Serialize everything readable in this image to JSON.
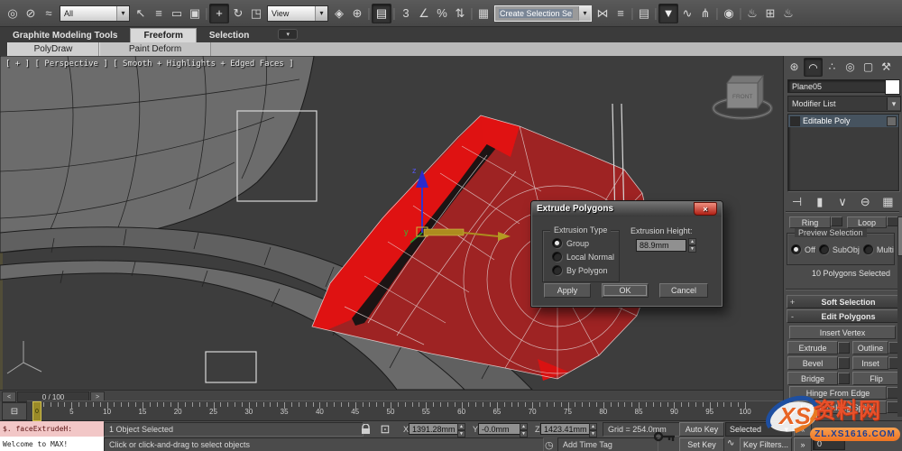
{
  "colors": {
    "selected_face_red": "#e01010",
    "mesh_red": "#9e2323",
    "mesh_gray": "#6c6c6c",
    "viewport_bg": "#3d3d3d",
    "panel_bg": "#4b4b4b",
    "gizmo_z_blue": "#3333cc",
    "gizmo_x_yellow": "#ad8c1f",
    "listener_pink": "#f2c7c7",
    "watermark_orange": "#f08233",
    "watermark_red": "#e8502a",
    "watermark_blue": "#1e4fa1"
  },
  "toolbar": {
    "selection_filter_value": "All",
    "coord_system_value": "View",
    "named_selection_placeholder": "Create Selection Se",
    "dd_arrow": "▾",
    "seg1": [
      {
        "name": "select-and-link-icon",
        "glyph": "◎"
      },
      {
        "name": "unlink-selection-icon",
        "glyph": "⊘"
      },
      {
        "name": "bind-to-space-warp-icon",
        "glyph": "≈"
      }
    ],
    "seg2": [
      {
        "name": "select-object-icon",
        "glyph": "↖"
      },
      {
        "name": "select-by-name-icon",
        "glyph": "≡"
      },
      {
        "name": "rectangular-selection-region-icon",
        "glyph": "▭"
      },
      {
        "name": "window-crossing-icon",
        "glyph": "▣"
      },
      {
        "name": "separator",
        "glyph": "|"
      },
      {
        "name": "select-and-move-icon",
        "glyph": "+",
        "active": true
      },
      {
        "name": "select-and-rotate-icon",
        "glyph": "↻"
      },
      {
        "name": "select-and-scale-icon",
        "glyph": "◳"
      }
    ],
    "seg3": [
      {
        "name": "use-pivot-point-center-icon",
        "glyph": "◈"
      },
      {
        "name": "select-and-manipulate-icon",
        "glyph": "⊕"
      },
      {
        "name": "separator",
        "glyph": "|"
      },
      {
        "name": "keyboard-shortcut-override-icon",
        "glyph": "▤",
        "active": true
      },
      {
        "name": "separator",
        "glyph": "|"
      },
      {
        "name": "snaps-toggle-3d-icon",
        "glyph": "3"
      },
      {
        "name": "angle-snap-icon",
        "glyph": "∠"
      },
      {
        "name": "percent-snap-icon",
        "glyph": "%"
      },
      {
        "name": "spinner-snap-icon",
        "glyph": "⇅"
      },
      {
        "name": "separator",
        "glyph": "|"
      },
      {
        "name": "edit-named-selection-sets-icon",
        "glyph": "▦"
      }
    ],
    "seg4": [
      {
        "name": "mirror-icon",
        "glyph": "⋈"
      },
      {
        "name": "align-icon",
        "glyph": "≡"
      },
      {
        "name": "separator",
        "glyph": "|"
      },
      {
        "name": "layer-manager-icon",
        "glyph": "▤"
      },
      {
        "name": "separator",
        "glyph": "|"
      },
      {
        "name": "graphite-ribbon-toggle-icon",
        "glyph": "▼",
        "active": true
      },
      {
        "name": "curve-editor-icon",
        "glyph": "∿"
      },
      {
        "name": "schematic-view-icon",
        "glyph": "⋔"
      },
      {
        "name": "separator",
        "glyph": "|"
      },
      {
        "name": "material-editor-icon",
        "glyph": "◉"
      },
      {
        "name": "separator",
        "glyph": "|"
      },
      {
        "name": "render-setup-icon",
        "glyph": "♨"
      },
      {
        "name": "rendered-frame-window-icon",
        "glyph": "⊞"
      },
      {
        "name": "render-production-icon",
        "glyph": "♨"
      }
    ]
  },
  "ribbon": {
    "tabs": [
      {
        "label": "Graphite Modeling Tools"
      },
      {
        "label": "Freeform"
      },
      {
        "label": "Selection"
      }
    ],
    "minimize_glyph": "▾",
    "subtabs": [
      {
        "label": "PolyDraw"
      },
      {
        "label": "Paint Deform"
      }
    ]
  },
  "viewport": {
    "label": "[ + ] [ Perspective ] [ Smooth + Highlights + Edged Faces ]",
    "viewcube_face": "FRONT",
    "gizmo_z": "z",
    "gizmo_y": "y"
  },
  "dialog": {
    "title": "Extrude Polygons",
    "close_glyph": "×",
    "group_label": "Extrusion Type",
    "radios": [
      {
        "label": "Group",
        "selected": true
      },
      {
        "label": "Local Normal",
        "selected": false
      },
      {
        "label": "By Polygon",
        "selected": false
      }
    ],
    "height_label": "Extrusion Height:",
    "height_value": "88.9mm",
    "apply_label": "Apply",
    "ok_label": "OK",
    "cancel_label": "Cancel"
  },
  "command_panel": {
    "tabs": [
      {
        "name": "create-tab-icon",
        "glyph": "⊛"
      },
      {
        "name": "modify-tab-icon",
        "glyph": "◠",
        "active": true
      },
      {
        "name": "hierarchy-tab-icon",
        "glyph": "∴"
      },
      {
        "name": "motion-tab-icon",
        "glyph": "◎"
      },
      {
        "name": "display-tab-icon",
        "glyph": "▢"
      },
      {
        "name": "utilities-tab-icon",
        "glyph": "⚒"
      }
    ],
    "object_name": "Plane05",
    "modifier_list_label": "Modifier List",
    "stack_item": "Editable Poly",
    "stack_tools": [
      {
        "name": "pin-stack-icon",
        "glyph": "⊣"
      },
      {
        "name": "show-end-result-icon",
        "glyph": "▮"
      },
      {
        "name": "make-unique-icon",
        "glyph": "∨"
      },
      {
        "name": "remove-modifier-icon",
        "glyph": "⊖"
      },
      {
        "name": "configure-modifier-sets-icon",
        "glyph": "▦"
      }
    ],
    "ring_label": "Ring",
    "loop_label": "Loop",
    "preview_selection": {
      "label": "Preview Selection",
      "options": [
        {
          "label": "Off",
          "selected": true
        },
        {
          "label": "SubObj",
          "selected": false
        },
        {
          "label": "Multi",
          "selected": false
        }
      ]
    },
    "selection_status": "10 Polygons Selected",
    "rollout_soft": {
      "state": "+",
      "label": "Soft Selection"
    },
    "rollout_edit": {
      "state": "-",
      "label": "Edit Polygons"
    },
    "buttons": {
      "insert_vertex": "Insert Vertex",
      "extrude": "Extrude",
      "outline": "Outline",
      "bevel": "Bevel",
      "inset": "Inset",
      "bridge": "Bridge",
      "flip": "Flip",
      "hinge": "Hinge From Edge",
      "spline": "Extrude Along Spline"
    }
  },
  "timeline": {
    "trackbar_value": "0 / 100",
    "prev_glyph": "<",
    "next_glyph": ">",
    "frame_start": 0,
    "frame_end": 100,
    "label_step": 5,
    "slider_frame": "0",
    "ruler_toggle_glyph": "⊟"
  },
  "status": {
    "listener_line1": "$. faceExtrudeH:",
    "listener_line2": "Welcome to MAX!",
    "selection": "1 Object Selected",
    "prompt": "Click or click-and-drag to select objects",
    "x_label": "X:",
    "x_value": "1391.28mm",
    "y_label": "Y:",
    "y_value": "-0.0mm",
    "z_label": "Z:",
    "z_value": "1423.41mm",
    "grid": "Grid = 254.0mm",
    "time_tag_glyph": "◷",
    "add_time_tag": "Add Time Tag",
    "auto_key": "Auto Key",
    "set_key": "Set Key",
    "key_mode_value": "Selected",
    "key_filters": "Key Filters...",
    "curve_glyph": "∿",
    "go_start_glyph": "«",
    "go_end_glyph": "»",
    "frame_field": "0",
    "abs_mode_glyph": "⊡"
  },
  "watermark": {
    "logo": "XS",
    "site": "资料网",
    "url": "ZL.XS1616.COM"
  }
}
